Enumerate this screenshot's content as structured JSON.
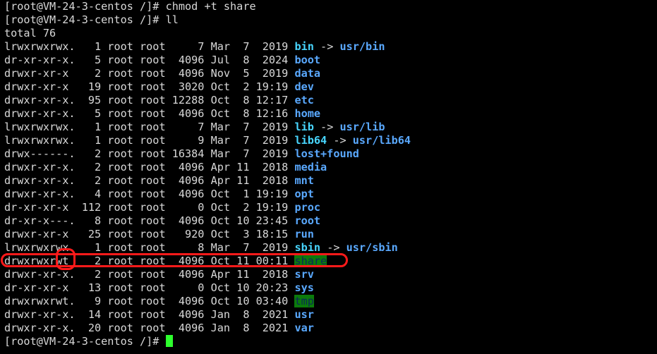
{
  "terminal": {
    "prompt": "[root@VM-24-3-centos /]# ",
    "commands": [
      "chmod +t share",
      "ll"
    ],
    "total": "total 76",
    "rows": [
      {
        "meta": "lrwxrwxrwx.   1 root root     7 Mar  7  2019 ",
        "name": "bin",
        "type": "link",
        "target": "usr/bin"
      },
      {
        "meta": "dr-xr-xr-x.   5 root root  4096 Jul  8  2024 ",
        "name": "boot",
        "type": "dir"
      },
      {
        "meta": "drwxr-xr-x    2 root root  4096 Nov  5  2019 ",
        "name": "data",
        "type": "dir"
      },
      {
        "meta": "drwxr-xr-x   19 root root  3020 Oct  2 19:19 ",
        "name": "dev",
        "type": "dir"
      },
      {
        "meta": "drwxr-xr-x.  95 root root 12288 Oct  8 12:17 ",
        "name": "etc",
        "type": "dir"
      },
      {
        "meta": "drwxr-xr-x.   5 root root  4096 Oct  8 12:16 ",
        "name": "home",
        "type": "dir"
      },
      {
        "meta": "lrwxrwxrwx.   1 root root     7 Mar  7  2019 ",
        "name": "lib",
        "type": "link",
        "target": "usr/lib"
      },
      {
        "meta": "lrwxrwxrwx.   1 root root     9 Mar  7  2019 ",
        "name": "lib64",
        "type": "link",
        "target": "usr/lib64"
      },
      {
        "meta": "drwx------.   2 root root 16384 Mar  7  2019 ",
        "name": "lost+found",
        "type": "dir"
      },
      {
        "meta": "drwxr-xr-x.   2 root root  4096 Apr 11  2018 ",
        "name": "media",
        "type": "dir"
      },
      {
        "meta": "drwxr-xr-x.   2 root root  4096 Apr 11  2018 ",
        "name": "mnt",
        "type": "dir"
      },
      {
        "meta": "drwxr-xr-x.   4 root root  4096 Oct  1 19:19 ",
        "name": "opt",
        "type": "dir"
      },
      {
        "meta": "dr-xr-xr-x  112 root root     0 Oct  2 19:19 ",
        "name": "proc",
        "type": "dir"
      },
      {
        "meta": "dr-xr-x---.   8 root root  4096 Oct 10 23:45 ",
        "name": "root",
        "type": "dir"
      },
      {
        "meta": "drwxr-xr-x   25 root root   920 Oct  3 18:15 ",
        "name": "run",
        "type": "dir"
      },
      {
        "meta": "lrwxrwxrwx.   1 root root     8 Mar  7  2019 ",
        "name": "sbin",
        "type": "link",
        "target": "usr/sbin"
      },
      {
        "meta": "drwxrwxrwt    2 root root  4096 Oct 11 00:11 ",
        "name": "share",
        "type": "sticky"
      },
      {
        "meta": "drwxr-xr-x.   2 root root  4096 Apr 11  2018 ",
        "name": "srv",
        "type": "dir"
      },
      {
        "meta": "dr-xr-xr-x   13 root root     0 Oct 10 20:23 ",
        "name": "sys",
        "type": "dir"
      },
      {
        "meta": "drwxrwxrwt.   9 root root  4096 Oct 10 03:40 ",
        "name": "tmp",
        "type": "sticky"
      },
      {
        "meta": "drwxr-xr-x.  14 root root  4096 Jan  8  2021 ",
        "name": "usr",
        "type": "dir"
      },
      {
        "meta": "drwxr-xr-x.  20 root root  4096 Jan  8  2021 ",
        "name": "var",
        "type": "dir"
      }
    ],
    "link_arrow": " -> ",
    "colors": {
      "background": "#000000",
      "text": "#d8d8d8",
      "directory": "#5aa9ff",
      "symlink": "#48d6ff",
      "sticky_background": "#0b7a0b",
      "cursor": "#2dff2d",
      "annotation": "#ff1a1a"
    }
  }
}
